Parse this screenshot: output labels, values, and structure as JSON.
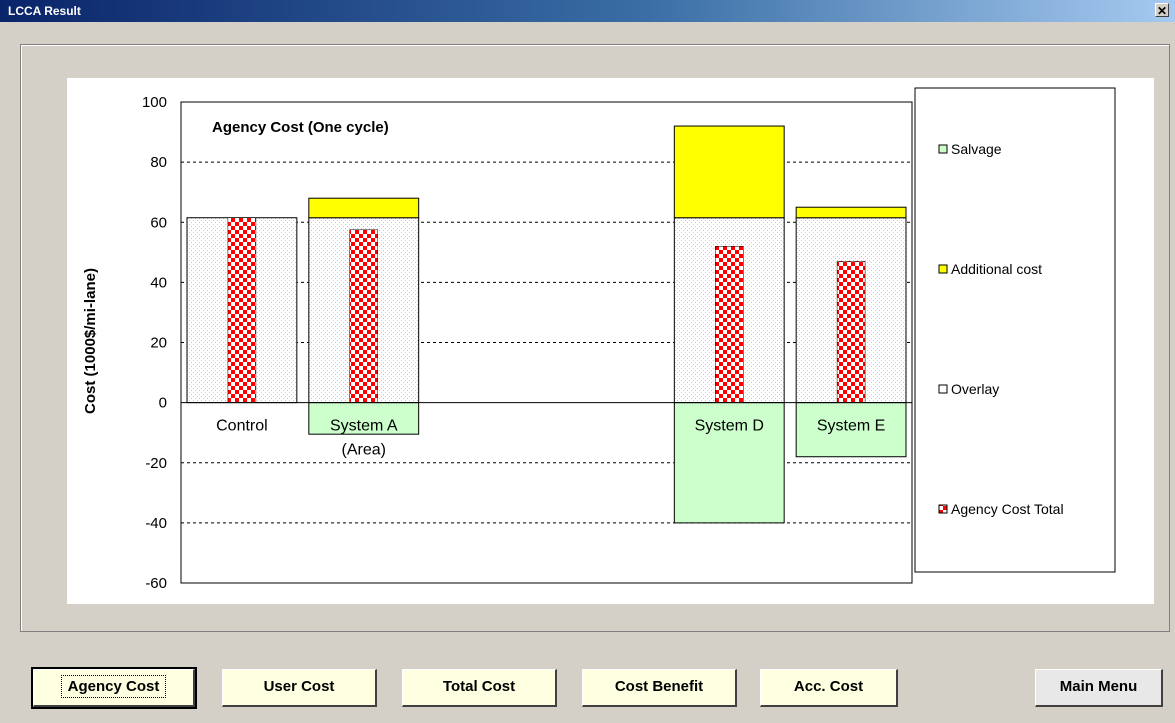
{
  "window": {
    "title": "LCCA Result",
    "close_glyph": "✕"
  },
  "buttons": {
    "agency_cost": "Agency Cost",
    "user_cost": "User Cost",
    "total_cost": "Total Cost",
    "cost_benefit": "Cost Benefit",
    "acc_cost": "Acc. Cost",
    "main_menu": "Main Menu"
  },
  "chart_data": {
    "type": "bar",
    "title": "Agency Cost (One cycle)",
    "ylabel": "Cost  (1000$/mi-lane)",
    "ylim": [
      -60,
      100
    ],
    "yticks": [
      "100",
      "80",
      "60",
      "40",
      "20",
      "0",
      "-20",
      "-40",
      "-60"
    ],
    "gridlines": "dashed",
    "legend_position": "right",
    "categories": [
      {
        "label": "Control",
        "sublabel": ""
      },
      {
        "label": "System A",
        "sublabel": "(Area)"
      },
      {
        "label": "",
        "sublabel": ""
      },
      {
        "label": "",
        "sublabel": ""
      },
      {
        "label": "System D",
        "sublabel": ""
      },
      {
        "label": "System E",
        "sublabel": ""
      }
    ],
    "series": [
      {
        "name": "Salvage",
        "color": "#ccffcc",
        "values": [
          0,
          -10.5,
          null,
          null,
          -40,
          -18
        ]
      },
      {
        "name": "Additional cost",
        "color": "#ffff00",
        "values": [
          0,
          6.5,
          null,
          null,
          30.5,
          3.5
        ]
      },
      {
        "name": "Overlay",
        "color": "#ffffff",
        "values": [
          61.5,
          61.5,
          null,
          null,
          61.5,
          61.5
        ]
      },
      {
        "name": "Agency Cost Total",
        "color": "#ff0000",
        "values": [
          61.5,
          57.5,
          null,
          null,
          52,
          47
        ]
      }
    ]
  }
}
